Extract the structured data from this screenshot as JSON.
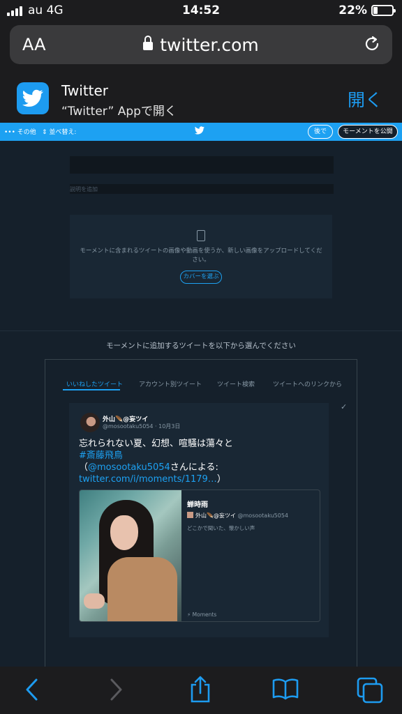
{
  "status": {
    "carrier": "au 4G",
    "time": "14:52",
    "battery": "22%"
  },
  "browser": {
    "text_size_label": "AA",
    "url": "twitter.com"
  },
  "app_banner": {
    "app_name": "Twitter",
    "subtitle": "“Twitter” Appで開く",
    "open_label": "開く"
  },
  "toolbar": {
    "more": "••• その他",
    "sort": "⇕ 並べ替え:",
    "later": "後で",
    "publish": "モーメントを公開"
  },
  "editor": {
    "description_placeholder": "説明を追加",
    "cover_text": "モーメントに含まれるツイートの画像や動画を使うか、新しい画像をアップロードしてください。",
    "cover_button": "カバーを選ぶ"
  },
  "picker": {
    "heading": "モーメントに追加するツイートを以下から選んでください",
    "tabs": [
      "いいねしたツイート",
      "アカウント別ツイート",
      "ツイート検索",
      "ツイートへのリンクから"
    ],
    "tweet": {
      "user_name": "外山🪶@妄ツイ",
      "handle_date": "@mosootaku5054 · 10月3日",
      "line1": "忘れられない夏、幻想、喧騒は蕩々と",
      "hashtag": "#斎藤飛鳥",
      "by_open": "（",
      "mention": "@mosootaku5054",
      "by_close": "さんによる:",
      "link": "twitter.com/i/moments/1179…",
      "link_close": "）",
      "card": {
        "title": "蝉時雨",
        "author": "外山🪶@妄ツイ",
        "author_handle": "@mosootaku5054",
        "description": "どこかで聞いた、懐かしい声",
        "footer": "⚡ Moments"
      }
    }
  },
  "colors": {
    "accent": "#1da1f2",
    "background": "#15202b",
    "ios_blue": "#1d9bf0"
  }
}
